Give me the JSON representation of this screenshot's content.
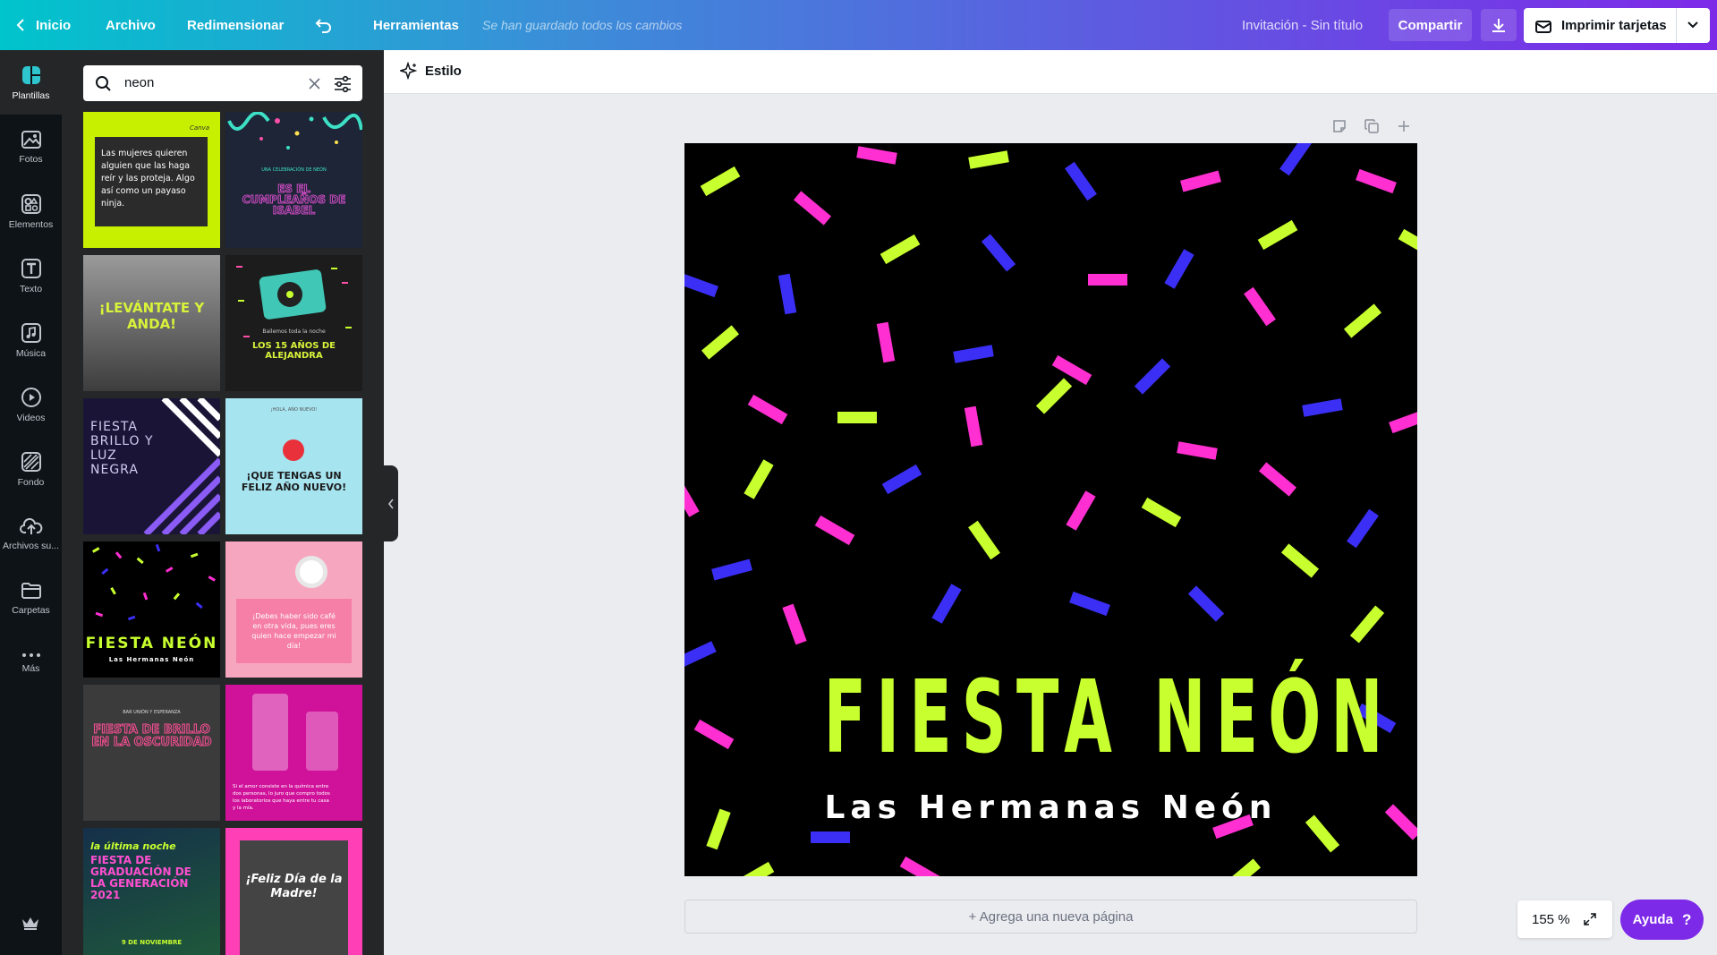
{
  "topbar": {
    "home": "Inicio",
    "file": "Archivo",
    "resize": "Redimensionar",
    "tools": "Herramientas",
    "saved_status": "Se han guardado todos los cambios",
    "doc_title": "Invitación - Sin título",
    "share": "Compartir",
    "print": "Imprimir tarjetas"
  },
  "rail": {
    "items": [
      {
        "label": "Plantillas",
        "icon": "templates-icon"
      },
      {
        "label": "Fotos",
        "icon": "photos-icon"
      },
      {
        "label": "Elementos",
        "icon": "elements-icon"
      },
      {
        "label": "Texto",
        "icon": "text-icon"
      },
      {
        "label": "Música",
        "icon": "music-icon"
      },
      {
        "label": "Videos",
        "icon": "video-icon"
      },
      {
        "label": "Fondo",
        "icon": "background-icon"
      },
      {
        "label": "Archivos su...",
        "icon": "upload-icon"
      },
      {
        "label": "Carpetas",
        "icon": "folder-icon"
      },
      {
        "label": "Más",
        "icon": "more-icon"
      }
    ]
  },
  "search": {
    "value": "neon"
  },
  "templates": {
    "t1": "Las mujeres quieren alguien que las haga reír y las proteja. Algo así como un payaso ninja.",
    "t1_brand": "Canva",
    "t2_small": "UNA CELEBRACIÓN DE NEÓN",
    "t2": "ES EL CUMPLEAÑOS DE ISABEL",
    "t3": "¡LEVÁNTATE Y ANDA!",
    "t4_small": "Bailemos toda la noche",
    "t4": "LOS 15 AÑOS DE ALEJANDRA",
    "t5": "FIESTA BRILLO Y LUZ NEGRA",
    "t6_small": "¡HOLA, AÑO NUEVO!",
    "t6": "¡QUE TENGAS UN FELIZ AÑO NUEVO!",
    "t7": "FIESTA NEÓN",
    "t7_sub": "Las Hermanas Neón",
    "t8": "¡Debes haber sido café en otra vida, pues eres quien hace empezar mi día!",
    "t9_small": "BAR UNIÓN Y ESPERANZA",
    "t9": "FIESTA DE BRILLO EN LA OSCURIDAD",
    "t10": "Si el amor consiste en la química entre dos personas, lo juro que compro todos los laboratorios que haya entre tu casa y la mía.",
    "t11_script": "la última noche",
    "t11": "FIESTA DE GRADUACIÓN DE LA GENERACIÓN 2021",
    "t11_date": "9 DE NOVIEMBRE",
    "t12": "¡Feliz Día de la Madre!"
  },
  "editor": {
    "style_button": "Estilo",
    "canvas_title": "FIESTA NEÓN",
    "canvas_subtitle": "Las Hermanas Neón",
    "add_page": "+ Agrega una nueva página",
    "zoom": "155 %",
    "help": "Ayuda",
    "help_glyph": "?"
  },
  "colors": {
    "neon_green": "#c8ff2e",
    "neon_pink": "#ff2fd1",
    "neon_blue": "#3b2ff5",
    "accent_purple": "#7d2ae8"
  }
}
